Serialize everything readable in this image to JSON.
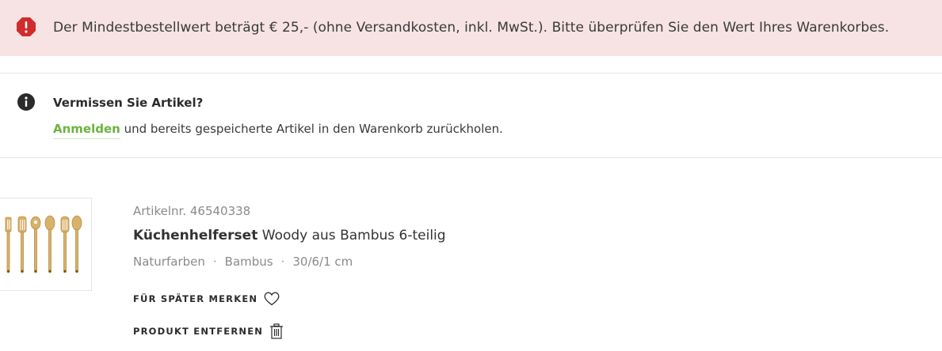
{
  "alert": {
    "icon": "exclamation-octagon-icon",
    "color": "#d12b2b",
    "message": "Der Mindestbestellwert beträgt € 25,- (ohne Versandkosten, inkl. MwSt.). Bitte überprüfen Sie den Wert Ihres Warenkorbes."
  },
  "info": {
    "icon": "info-icon",
    "title": "Vermissen Sie Artikel?",
    "login_link": "Anmelden",
    "text": "und bereits gespeicherte Artikel in den Warenkorb zurückholen."
  },
  "product": {
    "image": "bamboo-utensils-image",
    "article_number": "Artikelnr. 46540338",
    "brand": "Küchenhelferset",
    "name": "Woody aus Bambus 6-teilig",
    "attributes": [
      "Naturfarben",
      "Bambus",
      "30/6/1 cm"
    ],
    "attribute_separator": "·",
    "save_label": "FÜR SPÄTER MERKEN",
    "remove_label": "PRODUKT ENTFERNEN"
  },
  "colors": {
    "alert_bg": "#f7e3e3",
    "link": "#6cb33f"
  }
}
